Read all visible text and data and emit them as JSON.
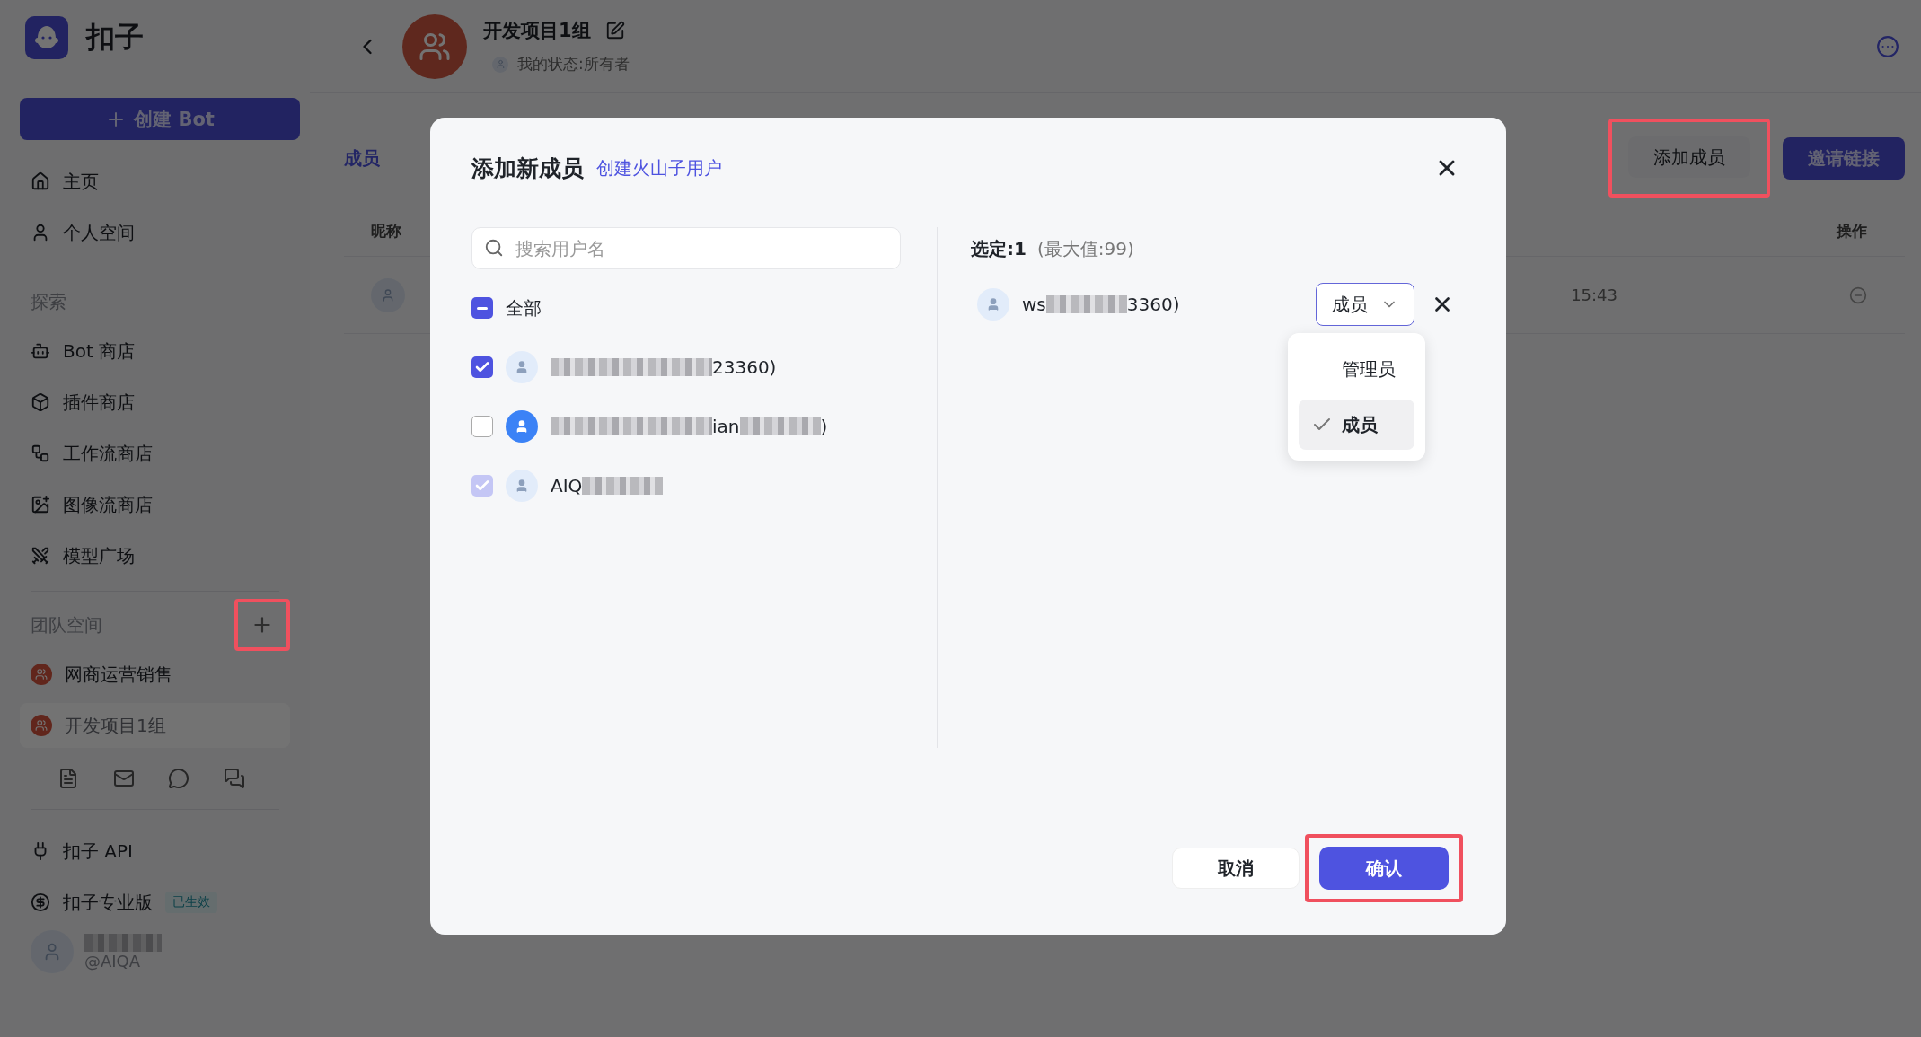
{
  "sidebar": {
    "logo_text": "扣子",
    "create_button": "创建 Bot",
    "nav": [
      {
        "label": "主页"
      },
      {
        "label": "个人空间"
      }
    ],
    "explore_title": "探索",
    "explore": [
      {
        "label": "Bot 商店"
      },
      {
        "label": "插件商店"
      },
      {
        "label": "工作流商店"
      },
      {
        "label": "图像流商店"
      },
      {
        "label": "模型广场"
      }
    ],
    "team_title": "团队空间",
    "add_team_highlighted": true,
    "teams": [
      {
        "label": "网商运营销售",
        "selected": false
      },
      {
        "label": "开发项目1组",
        "selected": true
      }
    ],
    "bottom": [
      {
        "label": "扣子 API"
      },
      {
        "label": "扣子专业版",
        "badge": "已生效"
      }
    ],
    "user": {
      "handle": "@AIQA"
    }
  },
  "header": {
    "title": "开发项目1组",
    "status": "我的状态:所有者"
  },
  "members_page": {
    "tab": "成员",
    "add_button": {
      "label": "添加成员",
      "highlighted": true
    },
    "invite_button": "邀请链接",
    "columns": [
      "昵称",
      "操作"
    ],
    "row": {
      "time": "15:43"
    }
  },
  "dialog": {
    "title": "添加新成员",
    "link": "创建火山子用户",
    "search": {
      "placeholder": "搜索用户名"
    },
    "all": {
      "label": "全部",
      "checked": true,
      "indeterminate": true
    },
    "users": [
      {
        "checked": true,
        "disabled": false,
        "color": "#e2ecfa",
        "name": [
          {
            "kind": "blur"
          },
          {
            "kind": "text",
            "text": "23360)"
          }
        ]
      },
      {
        "checked": false,
        "disabled": false,
        "color": "#3b82f6",
        "name": [
          {
            "kind": "blur"
          },
          {
            "kind": "text",
            "text": "ian"
          },
          {
            "kind": "blur"
          },
          {
            "kind": "text",
            "text": ")"
          }
        ]
      },
      {
        "checked": true,
        "disabled": true,
        "color": "#e2ecfa",
        "name": [
          {
            "kind": "text",
            "text": "AIQ"
          },
          {
            "kind": "blur"
          }
        ]
      }
    ],
    "selected_label": "选定:1",
    "max_label": "(最大值:99)",
    "selected_users": [
      {
        "name": [
          {
            "kind": "text",
            "text": "ws"
          },
          {
            "kind": "blur"
          },
          {
            "kind": "text",
            "text": "3360)"
          }
        ],
        "role": "成员",
        "menu": [
          {
            "label": "管理员",
            "selected": false
          },
          {
            "label": "成员",
            "selected": true
          }
        ]
      }
    ],
    "cancel": "取消",
    "confirm": {
      "label": "确认",
      "highlighted": true
    }
  }
}
